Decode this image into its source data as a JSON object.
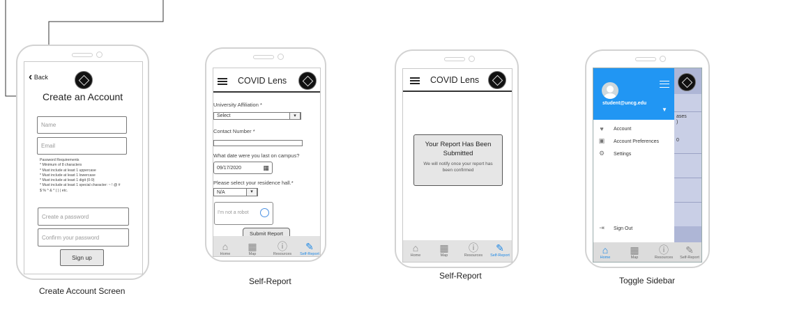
{
  "captions": {
    "create_account": "Create Account Screen",
    "self_report_1": "Self-Report",
    "self_report_2": "Self-Report",
    "toggle_sidebar": "Toggle Sidebar"
  },
  "create_account_screen": {
    "back_label": "Back",
    "title": "Create an Account",
    "name_placeholder": "Name",
    "email_placeholder": "Email",
    "password_requirements": [
      "Password Requirements",
      "* Minimum of 8 characters",
      "* Must include at least 1 uppercase",
      "* Must include at least 1 lowercase",
      "* Must include at least 1 digit (0-9)",
      "* Must include at least 1 special character: ~ ! @ #",
      "$ % ^ & * ( ) | etc."
    ],
    "create_password_placeholder": "Create a password",
    "confirm_password_placeholder": "Confirm your password",
    "signup_label": "Sign up"
  },
  "app": {
    "title": "COVID Lens"
  },
  "self_report_form": {
    "affiliation_label": "University Affiliation *",
    "affiliation_value": "Select",
    "contact_label": "Contact Number *",
    "date_question": "What date were you last on campus?",
    "date_value": "09/17/2020",
    "residence_label": "Please select your residence hall.*",
    "residence_value": "N/A",
    "captcha_label": "I'm not a robot",
    "submit_label": "Submit Report"
  },
  "submitted_dialog": {
    "title": "Your Report Has Been Submitted",
    "message": "We will notify once your report has been confirmed"
  },
  "nav": {
    "home": "Home",
    "map": "Map",
    "resources": "Resources",
    "self_report": "Self-Report"
  },
  "sidebar": {
    "email": "student@uncg.edu",
    "items": [
      "Account",
      "Account Preferences",
      "Settings"
    ],
    "sign_out": "Sign Out",
    "bg_fragments": [
      "ases",
      ")",
      "0"
    ]
  },
  "colors": {
    "accent": "#2196f3",
    "nav_bg": "#e3e3e3",
    "active": "#1e88e5"
  }
}
